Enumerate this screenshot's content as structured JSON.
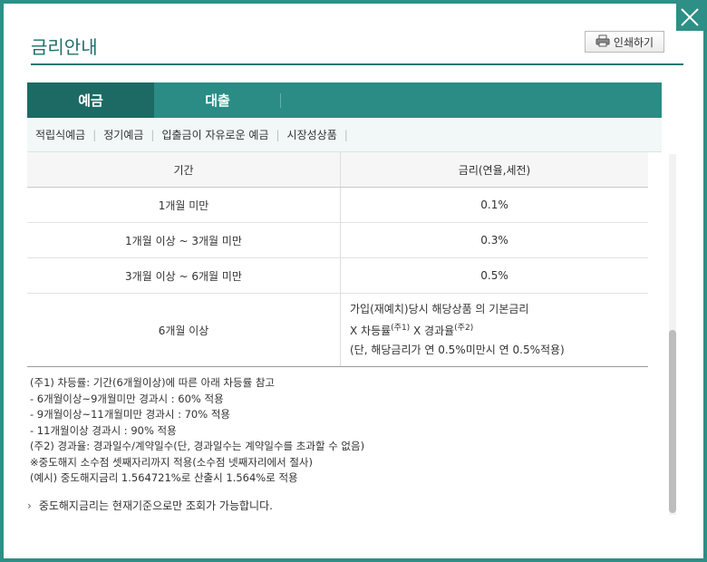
{
  "header": {
    "title": "금리안내",
    "print_label": "인쇄하기"
  },
  "tabs": [
    {
      "label": "예금",
      "active": true
    },
    {
      "label": "대출",
      "active": false
    }
  ],
  "subtabs": [
    "적립식예금",
    "정기예금",
    "입출금이 자유로운 예금",
    "시장성상품"
  ],
  "table": {
    "headers": [
      "기간",
      "금리(연율,세전)"
    ],
    "rows": [
      {
        "period": "1개월 미만",
        "rate": "0.1%"
      },
      {
        "period": "1개월 이상 ~ 3개월 미만",
        "rate": "0.3%"
      },
      {
        "period": "3개월 이상 ~ 6개월 미만",
        "rate": "0.5%"
      }
    ],
    "last_row": {
      "period": "6개월 이상",
      "line1": "가입(재예치)당시 해당상품 의 기본금리",
      "line2_a": "X 차등률",
      "line2_sup1": "(주1)",
      "line2_b": " X 경과율",
      "line2_sup2": "(주2)",
      "line3": "(단, 해당금리가 연 0.5%미만시 연 0.5%적용)"
    }
  },
  "notes": [
    "(주1) 차등률: 기간(6개월이상)에 따른 아래 차등률 참고",
    " - 6개월이상~9개월미만 경과시 : 60% 적용",
    " - 9개월이상~11개월미만 경과시 : 70% 적용",
    " - 11개월이상 경과시 : 90% 적용",
    "(주2) 경과율: 경과일수/계약일수(단, 경과일수는 계약일수를 초과할 수 없음)",
    " ※중도해지 소수점 셋째자리까지 적용(소수점 넷째자리에서 절사)",
    " (예시) 중도해지금리 1.564721%로 산출시 1.564%로 적용"
  ],
  "footnote": "중도해지금리는 현재기준으로만 조회가 가능합니다.",
  "colors": {
    "accent": "#2a8c85",
    "active_tab": "#1d6a64",
    "border": "#2d8f86"
  },
  "icons": {
    "close": "close-icon",
    "print": "printer-icon",
    "bullet": "chevron-right-icon"
  }
}
